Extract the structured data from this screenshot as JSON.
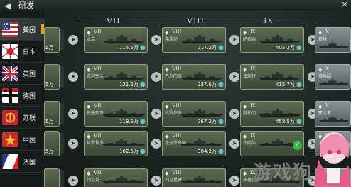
{
  "header": {
    "title": "研发",
    "back_icon": "back-arrow-icon",
    "close_icon": "close-icon"
  },
  "nations": [
    {
      "label": "美国",
      "flag": "usa-flag-icon",
      "selected": true
    },
    {
      "label": "日本",
      "flag": "japan-flag-icon",
      "selected": false
    },
    {
      "label": "英国",
      "flag": "uk-flag-icon",
      "selected": false
    },
    {
      "label": "德国",
      "flag": "germany-flag-icon",
      "selected": false
    },
    {
      "label": "苏联",
      "flag": "ussr-flag-icon",
      "selected": false
    },
    {
      "label": "中国",
      "flag": "china-flag-icon",
      "selected": false
    },
    {
      "label": "法国",
      "flag": "france-flag-icon",
      "selected": false
    }
  ],
  "tiers": [
    "VII",
    "VIII",
    "IX"
  ],
  "rows": [
    {
      "prev_cost": "5万",
      "cards": [
        {
          "tier": "VII",
          "name": "本森",
          "cost": "114.5万",
          "researched": false
        },
        {
          "tier": "VIII",
          "name": "弗莱彻",
          "cost": "217.2万",
          "researched": false
        },
        {
          "tier": "IX",
          "name": "萨姆纳",
          "cost": "405.3万",
          "researched": false
        }
      ],
      "next": {
        "tier": "X",
        "name": "基林"
      }
    },
    {
      "prev_cost": "5万",
      "cards": [
        {
          "tier": "VII",
          "name": "克利夫兰",
          "cost": "121.5万",
          "researched": false
        },
        {
          "tier": "VIII",
          "name": "巴尔的摩",
          "cost": "237.6万",
          "researched": false
        },
        {
          "tier": "IX",
          "name": "伍斯特",
          "cost": "415.7万",
          "researched": false
        }
      ],
      "next": {
        "tier": "X",
        "name": "得梅因"
      }
    },
    {
      "prev_cost": "5万",
      "cards": [
        {
          "tier": "VII",
          "name": "新墨西哥",
          "cost": "118.5万",
          "researched": false
        },
        {
          "tier": "VIII",
          "name": "科罗拉多",
          "cost": "267.3万",
          "researched": false
        },
        {
          "tier": "IX",
          "name": "俄勒冈",
          "cost": "458.5万",
          "researched": false
        }
      ],
      "next": {
        "tier": "X",
        "name": "蒙大拿"
      }
    },
    {
      "prev_cost": "5万",
      "cards": [
        {
          "tier": "VII",
          "name": "科罗拉多",
          "cost": "162.5万",
          "researched": false
        },
        {
          "tier": "VIII",
          "name": "北卡罗来纳",
          "cost": "304.2万",
          "researched": false
        },
        {
          "tier": "IX",
          "name": "衣阿华",
          "cost": "",
          "researched": true
        }
      ],
      "next": {
        "tier": "X",
        "name": ""
      }
    },
    {
      "prev_cost": "",
      "cards": [
        {
          "tier": "VII",
          "name": "约克城",
          "cost": "",
          "researched": false
        },
        {
          "tier": "VIII",
          "name": "列克星敦",
          "cost": "",
          "researched": false
        },
        {
          "tier": "IX",
          "name": "埃塞克斯",
          "cost": "",
          "researched": false
        }
      ],
      "next": {
        "tier": "X",
        "name": ""
      }
    }
  ],
  "watermark": "游戏狗"
}
